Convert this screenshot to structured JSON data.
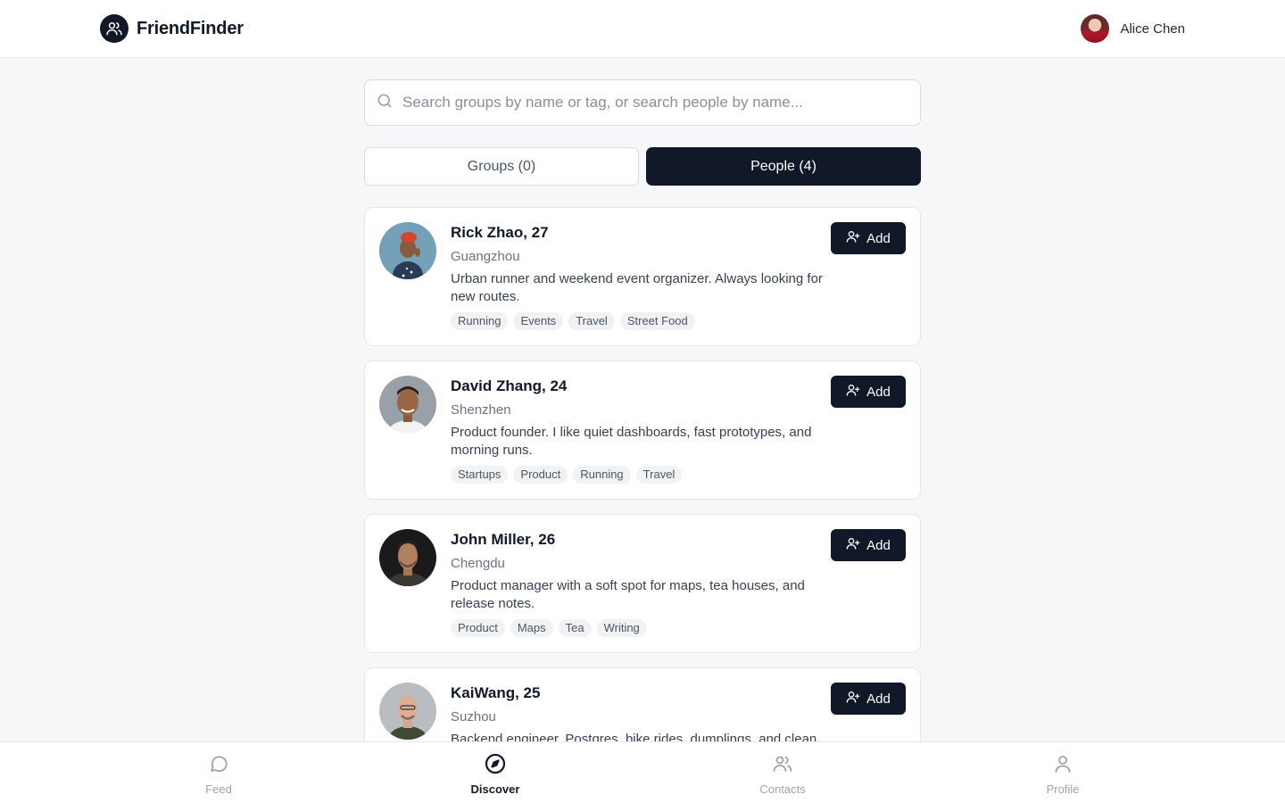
{
  "app": {
    "name": "FriendFinder"
  },
  "user": {
    "name": "Alice Chen"
  },
  "search": {
    "placeholder": "Search groups by name or tag, or search people by name..."
  },
  "tabs": [
    {
      "label": "Groups (0)",
      "active": false
    },
    {
      "label": "People (4)",
      "active": true
    }
  ],
  "people": [
    {
      "name": "Rick Zhao, 27",
      "city": "Guangzhou",
      "bio": "Urban runner and weekend event organizer. Always looking for new routes.",
      "tags": [
        "Running",
        "Events",
        "Travel",
        "Street Food"
      ],
      "add_label": "Add"
    },
    {
      "name": "David Zhang, 24",
      "city": "Shenzhen",
      "bio": "Product founder. I like quiet dashboards, fast prototypes, and morning runs.",
      "tags": [
        "Startups",
        "Product",
        "Running",
        "Travel"
      ],
      "add_label": "Add"
    },
    {
      "name": "John Miller, 26",
      "city": "Chengdu",
      "bio": "Product manager with a soft spot for maps, tea houses, and release notes.",
      "tags": [
        "Product",
        "Maps",
        "Tea",
        "Writing"
      ],
      "add_label": "Add"
    },
    {
      "name": "KaiWang, 25",
      "city": "Suzhou",
      "bio": "Backend engineer. Postgres, bike rides, dumplings, and clean",
      "tags": [],
      "add_label": "Add"
    }
  ],
  "bottom_nav": [
    {
      "label": "Feed",
      "icon": "chat-bubble-icon",
      "active": false
    },
    {
      "label": "Discover",
      "icon": "compass-icon",
      "active": true
    },
    {
      "label": "Contacts",
      "icon": "users-icon",
      "active": false
    },
    {
      "label": "Profile",
      "icon": "user-icon",
      "active": false
    }
  ],
  "colors": {
    "primary": "#111827",
    "background": "#f6f7f9",
    "muted": "#9ca3af",
    "tag_bg": "#f1f2f4"
  }
}
